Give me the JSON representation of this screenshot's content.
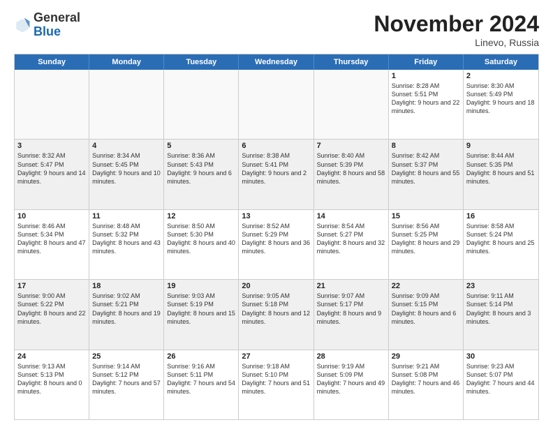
{
  "header": {
    "logo_general": "General",
    "logo_blue": "Blue",
    "month_title": "November 2024",
    "location": "Linevo, Russia"
  },
  "weekdays": [
    "Sunday",
    "Monday",
    "Tuesday",
    "Wednesday",
    "Thursday",
    "Friday",
    "Saturday"
  ],
  "rows": [
    [
      {
        "day": "",
        "info": "",
        "empty": true
      },
      {
        "day": "",
        "info": "",
        "empty": true
      },
      {
        "day": "",
        "info": "",
        "empty": true
      },
      {
        "day": "",
        "info": "",
        "empty": true
      },
      {
        "day": "",
        "info": "",
        "empty": true
      },
      {
        "day": "1",
        "info": "Sunrise: 8:28 AM\nSunset: 5:51 PM\nDaylight: 9 hours\nand 22 minutes.",
        "empty": false
      },
      {
        "day": "2",
        "info": "Sunrise: 8:30 AM\nSunset: 5:49 PM\nDaylight: 9 hours\nand 18 minutes.",
        "empty": false
      }
    ],
    [
      {
        "day": "3",
        "info": "Sunrise: 8:32 AM\nSunset: 5:47 PM\nDaylight: 9 hours\nand 14 minutes.",
        "empty": false
      },
      {
        "day": "4",
        "info": "Sunrise: 8:34 AM\nSunset: 5:45 PM\nDaylight: 9 hours\nand 10 minutes.",
        "empty": false
      },
      {
        "day": "5",
        "info": "Sunrise: 8:36 AM\nSunset: 5:43 PM\nDaylight: 9 hours\nand 6 minutes.",
        "empty": false
      },
      {
        "day": "6",
        "info": "Sunrise: 8:38 AM\nSunset: 5:41 PM\nDaylight: 9 hours\nand 2 minutes.",
        "empty": false
      },
      {
        "day": "7",
        "info": "Sunrise: 8:40 AM\nSunset: 5:39 PM\nDaylight: 8 hours\nand 58 minutes.",
        "empty": false
      },
      {
        "day": "8",
        "info": "Sunrise: 8:42 AM\nSunset: 5:37 PM\nDaylight: 8 hours\nand 55 minutes.",
        "empty": false
      },
      {
        "day": "9",
        "info": "Sunrise: 8:44 AM\nSunset: 5:35 PM\nDaylight: 8 hours\nand 51 minutes.",
        "empty": false
      }
    ],
    [
      {
        "day": "10",
        "info": "Sunrise: 8:46 AM\nSunset: 5:34 PM\nDaylight: 8 hours\nand 47 minutes.",
        "empty": false
      },
      {
        "day": "11",
        "info": "Sunrise: 8:48 AM\nSunset: 5:32 PM\nDaylight: 8 hours\nand 43 minutes.",
        "empty": false
      },
      {
        "day": "12",
        "info": "Sunrise: 8:50 AM\nSunset: 5:30 PM\nDaylight: 8 hours\nand 40 minutes.",
        "empty": false
      },
      {
        "day": "13",
        "info": "Sunrise: 8:52 AM\nSunset: 5:29 PM\nDaylight: 8 hours\nand 36 minutes.",
        "empty": false
      },
      {
        "day": "14",
        "info": "Sunrise: 8:54 AM\nSunset: 5:27 PM\nDaylight: 8 hours\nand 32 minutes.",
        "empty": false
      },
      {
        "day": "15",
        "info": "Sunrise: 8:56 AM\nSunset: 5:25 PM\nDaylight: 8 hours\nand 29 minutes.",
        "empty": false
      },
      {
        "day": "16",
        "info": "Sunrise: 8:58 AM\nSunset: 5:24 PM\nDaylight: 8 hours\nand 25 minutes.",
        "empty": false
      }
    ],
    [
      {
        "day": "17",
        "info": "Sunrise: 9:00 AM\nSunset: 5:22 PM\nDaylight: 8 hours\nand 22 minutes.",
        "empty": false
      },
      {
        "day": "18",
        "info": "Sunrise: 9:02 AM\nSunset: 5:21 PM\nDaylight: 8 hours\nand 19 minutes.",
        "empty": false
      },
      {
        "day": "19",
        "info": "Sunrise: 9:03 AM\nSunset: 5:19 PM\nDaylight: 8 hours\nand 15 minutes.",
        "empty": false
      },
      {
        "day": "20",
        "info": "Sunrise: 9:05 AM\nSunset: 5:18 PM\nDaylight: 8 hours\nand 12 minutes.",
        "empty": false
      },
      {
        "day": "21",
        "info": "Sunrise: 9:07 AM\nSunset: 5:17 PM\nDaylight: 8 hours\nand 9 minutes.",
        "empty": false
      },
      {
        "day": "22",
        "info": "Sunrise: 9:09 AM\nSunset: 5:15 PM\nDaylight: 8 hours\nand 6 minutes.",
        "empty": false
      },
      {
        "day": "23",
        "info": "Sunrise: 9:11 AM\nSunset: 5:14 PM\nDaylight: 8 hours\nand 3 minutes.",
        "empty": false
      }
    ],
    [
      {
        "day": "24",
        "info": "Sunrise: 9:13 AM\nSunset: 5:13 PM\nDaylight: 8 hours\nand 0 minutes.",
        "empty": false
      },
      {
        "day": "25",
        "info": "Sunrise: 9:14 AM\nSunset: 5:12 PM\nDaylight: 7 hours\nand 57 minutes.",
        "empty": false
      },
      {
        "day": "26",
        "info": "Sunrise: 9:16 AM\nSunset: 5:11 PM\nDaylight: 7 hours\nand 54 minutes.",
        "empty": false
      },
      {
        "day": "27",
        "info": "Sunrise: 9:18 AM\nSunset: 5:10 PM\nDaylight: 7 hours\nand 51 minutes.",
        "empty": false
      },
      {
        "day": "28",
        "info": "Sunrise: 9:19 AM\nSunset: 5:09 PM\nDaylight: 7 hours\nand 49 minutes.",
        "empty": false
      },
      {
        "day": "29",
        "info": "Sunrise: 9:21 AM\nSunset: 5:08 PM\nDaylight: 7 hours\nand 46 minutes.",
        "empty": false
      },
      {
        "day": "30",
        "info": "Sunrise: 9:23 AM\nSunset: 5:07 PM\nDaylight: 7 hours\nand 44 minutes.",
        "empty": false
      }
    ]
  ]
}
